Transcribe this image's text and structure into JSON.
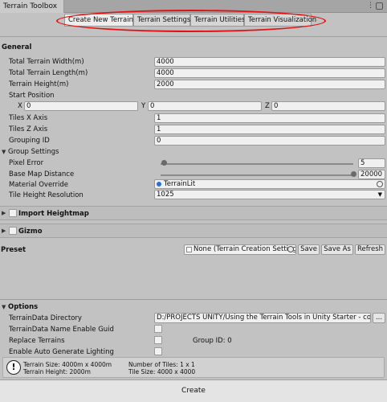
{
  "window": {
    "title": "Terrain Toolbox",
    "menu_icon": "⋮"
  },
  "tabs": [
    {
      "label": "Create New Terrain",
      "active": true
    },
    {
      "label": "Terrain Settings",
      "active": false
    },
    {
      "label": "Terrain Utilities",
      "active": false
    },
    {
      "label": "Terrain Visualization",
      "active": false
    }
  ],
  "general": {
    "header": "General",
    "width_label": "Total Terrain Width(m)",
    "width_value": "4000",
    "length_label": "Total Terrain Length(m)",
    "length_value": "4000",
    "height_label": "Terrain Height(m)",
    "height_value": "2000",
    "start_label": "Start Position",
    "x_label": "X",
    "x_value": "0",
    "y_label": "Y",
    "y_value": "0",
    "z_label": "Z",
    "z_value": "0",
    "tiles_x_label": "Tiles X Axis",
    "tiles_x_value": "1",
    "tiles_z_label": "Tiles Z Axis",
    "tiles_z_value": "1",
    "grouping_label": "Grouping ID",
    "grouping_value": "0"
  },
  "group_settings": {
    "header": "Group Settings",
    "pixel_error_label": "Pixel Error",
    "pixel_error_value": "5",
    "pixel_error_fraction": 0.02,
    "base_map_label": "Base Map Distance",
    "base_map_value": "20000",
    "base_map_fraction": 1.0,
    "material_label": "Material Override",
    "material_value": "TerrainLit",
    "tile_res_label": "Tile Height Resolution",
    "tile_res_value": "1025"
  },
  "import_heightmap": {
    "label": "Import Heightmap"
  },
  "gizmo": {
    "label": "Gizmo"
  },
  "preset": {
    "label": "Preset",
    "value": "None (Terrain Creation Setting",
    "save": "Save",
    "save_as": "Save As",
    "refresh": "Refresh"
  },
  "options": {
    "header": "Options",
    "dir_label": "TerrainData Directory",
    "dir_value": "D:/PROJECTS UNITY/Using the Terrain Tools in Unity Starter - copia/",
    "browse": "...",
    "guid_label": "TerrainData Name Enable Guid",
    "replace_label": "Replace Terrains",
    "group_id_text": "Group ID: 0",
    "auto_light_label": "Enable Auto Generate Lighting"
  },
  "info": {
    "size": "Terrain Size: 4000m x 4000m",
    "height": "Terrain Height: 2000m",
    "num_tiles": "Number of Tiles: 1 x 1",
    "tile_size": "Tile Size: 4000 x 4000"
  },
  "create_button": "Create"
}
